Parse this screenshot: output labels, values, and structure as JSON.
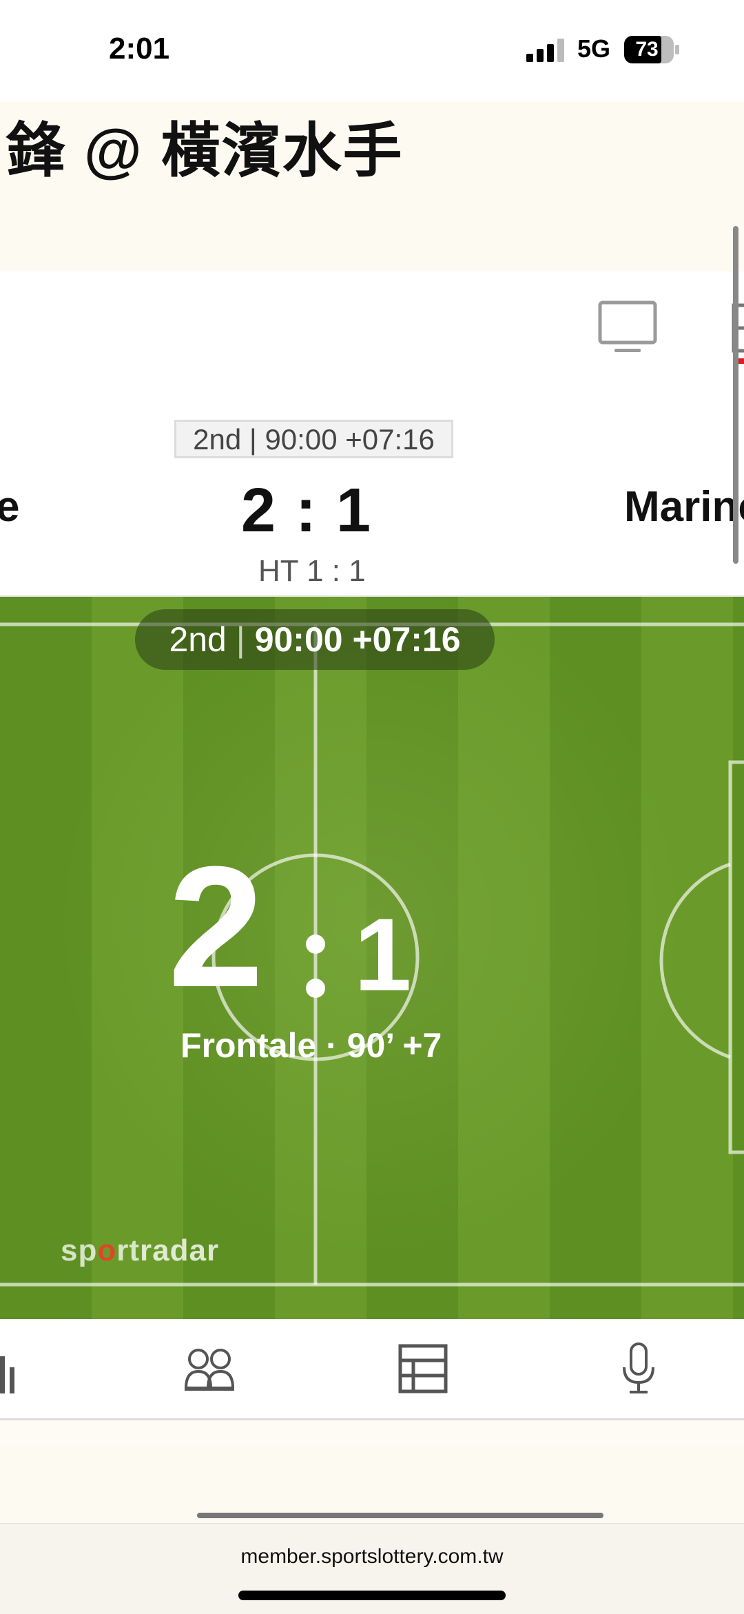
{
  "status_bar": {
    "time": "2:01",
    "network": "5G",
    "battery": "73"
  },
  "header": {
    "title": "鋒 @ 橫濱水手"
  },
  "scoreboard": {
    "period": "2nd | 90:00 +07:16",
    "home_team_partial": "e",
    "score": "2 : 1",
    "away_team_partial": "Marinc",
    "halftime": "HT 1 : 1"
  },
  "pitch": {
    "period_label": "2nd",
    "clock": "90:00 +07:16",
    "home_score": "2",
    "away_score": "1",
    "goal_caption": "Frontale · 90’ +7",
    "logo": {
      "a": "sp",
      "b": "o",
      "c": "rt",
      "d": "radar"
    }
  },
  "bottom_tabs": [
    {
      "name": "stats",
      "icon": "bar-chart-icon"
    },
    {
      "name": "lineups",
      "icon": "players-icon"
    },
    {
      "name": "table",
      "icon": "table-icon"
    },
    {
      "name": "commentary",
      "icon": "microphone-icon"
    }
  ],
  "browser": {
    "url": "member.sportslottery.com.tw"
  }
}
